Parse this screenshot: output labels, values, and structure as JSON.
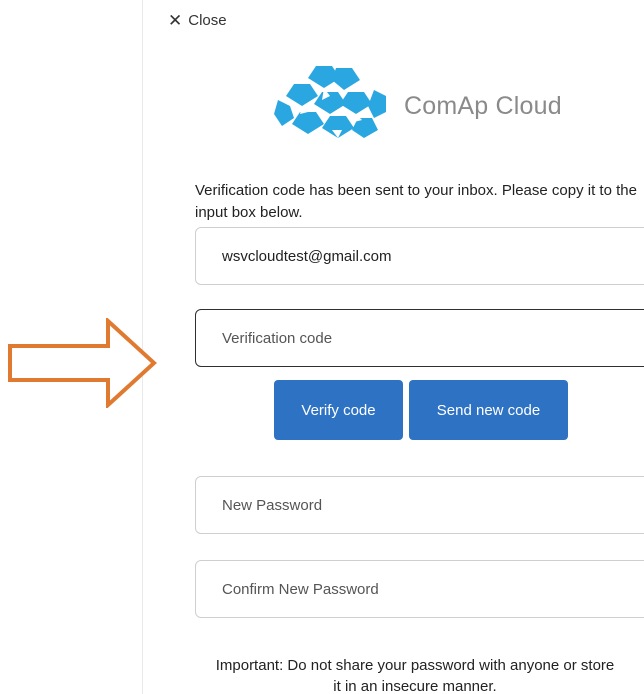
{
  "close": {
    "icon": "close-icon",
    "label": "Close"
  },
  "brand": {
    "name": "ComAp Cloud",
    "logo_icon": "comap-cloud-logo",
    "logo_color": "#2aa7e0"
  },
  "intro_text": "Verification code has been sent to your inbox. Please copy it to the input box below.",
  "email_field": {
    "value": "wsvcloudtest@gmail.com"
  },
  "code_field": {
    "value": "",
    "placeholder": "Verification code"
  },
  "buttons": {
    "verify_label": "Verify code",
    "resend_label": "Send new code",
    "color": "#2e72c4"
  },
  "new_password_field": {
    "value": "",
    "placeholder": "New Password"
  },
  "confirm_password_field": {
    "value": "",
    "placeholder": "Confirm New Password"
  },
  "notice": {
    "line1": "Important: Do not share your password with anyone or store",
    "line2": "it in an insecure manner."
  },
  "annotation": {
    "icon": "arrow-right-icon",
    "color": "#e07a30"
  }
}
